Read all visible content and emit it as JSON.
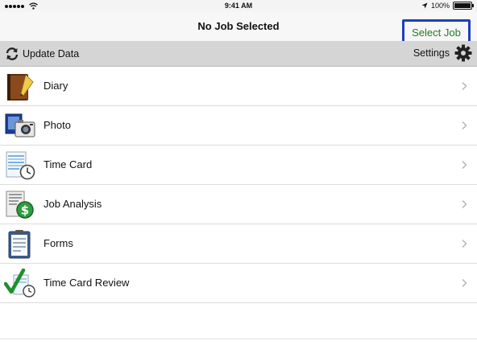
{
  "status_bar": {
    "time": "9:41 AM",
    "battery": "100%",
    "icons": [
      "signal-dots-icon",
      "wifi-icon",
      "location-arrow-icon",
      "battery-icon"
    ]
  },
  "nav": {
    "title": "No Job Selected",
    "select_job": "Select Job",
    "accent_color": "#1e7d22",
    "highlight_color": "#1f3fb8"
  },
  "toolbar": {
    "update_label": "Update Data",
    "settings_label": "Settings"
  },
  "menu": {
    "items": [
      {
        "label": "Diary",
        "icon": "diary-book-icon"
      },
      {
        "label": "Photo",
        "icon": "camera-photo-icon"
      },
      {
        "label": "Time Card",
        "icon": "time-card-clock-icon"
      },
      {
        "label": "Job Analysis",
        "icon": "job-analysis-dollar-icon"
      },
      {
        "label": "Forms",
        "icon": "clipboard-forms-icon"
      },
      {
        "label": "Time Card Review",
        "icon": "checkmark-review-icon"
      }
    ]
  }
}
